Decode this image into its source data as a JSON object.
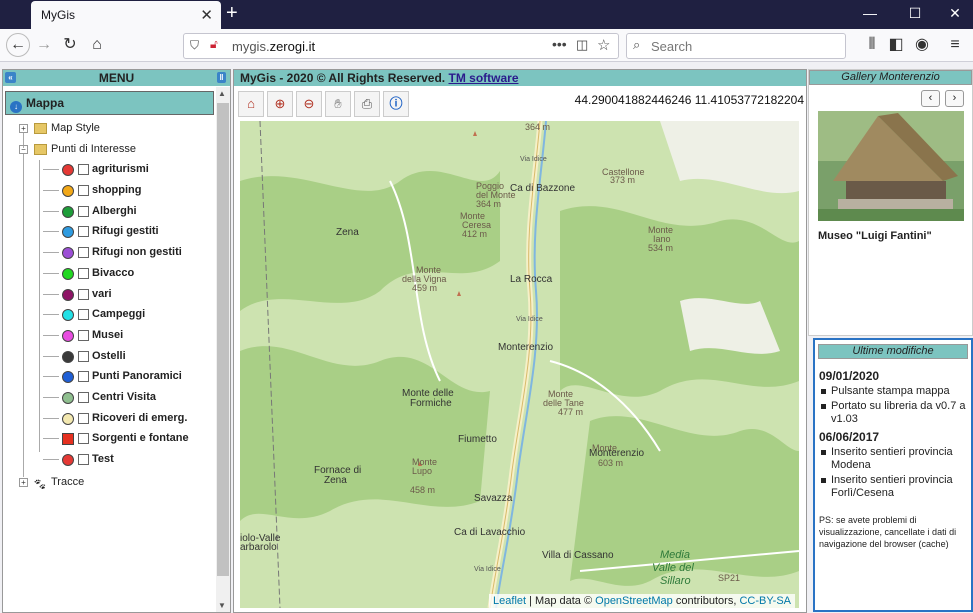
{
  "browser": {
    "tab_title": "MyGis",
    "url_prefix": "mygis.",
    "url_host": "zerogi.it",
    "search_placeholder": "Search"
  },
  "menu": {
    "title": "MENU",
    "mappa_label": "Mappa",
    "map_style_label": "Map Style",
    "poi_label": "Punti di Interesse",
    "tracce_label": "Tracce",
    "poi_items": [
      {
        "label": "agriturismi",
        "color": "#e53935"
      },
      {
        "label": "shopping",
        "color": "#f2a818"
      },
      {
        "label": "Alberghi",
        "color": "#1e9e3a"
      },
      {
        "label": "Rifugi gestiti",
        "color": "#2e9be0"
      },
      {
        "label": "Rifugi non gestiti",
        "color": "#9c4fd6"
      },
      {
        "label": "Bivacco",
        "color": "#22d822"
      },
      {
        "label": "vari",
        "color": "#8e1466"
      },
      {
        "label": "Campeggi",
        "color": "#22e0e6"
      },
      {
        "label": "Musei",
        "color": "#e84de0"
      },
      {
        "label": "Ostelli",
        "color": "#3a3a3a"
      },
      {
        "label": "Punti Panoramici",
        "color": "#1f5fd6"
      },
      {
        "label": "Centri Visita",
        "color": "#8fbf8f"
      },
      {
        "label": "Ricoveri di emerg.",
        "color": "#f3e8b0"
      },
      {
        "label": "Sorgenti e fontane",
        "color": "#e53020"
      },
      {
        "label": "Test",
        "color": "#e53935"
      }
    ]
  },
  "map": {
    "header_text": "MyGis - 2020 © All Rights Reserved. ",
    "header_link": "TM software",
    "coords": "44.290041882446246 11.41053772182204",
    "attribution": {
      "leaflet": "Leaflet",
      "sep": " | Map data © ",
      "osm": "OpenStreetMap",
      "contrib": " contributors, ",
      "license": "CC-BY-SA"
    },
    "labels": [
      {
        "text": "364 m"
      },
      {
        "text": "Ca di Bazzone"
      },
      {
        "text": "Poggio"
      },
      {
        "text": "del Monte"
      },
      {
        "text": "364 m"
      },
      {
        "text": "Castellone"
      },
      {
        "text": "373 m"
      },
      {
        "text": "Monte"
      },
      {
        "text": "Ceresa"
      },
      {
        "text": "412 m"
      },
      {
        "text": "Monte"
      },
      {
        "text": "Iano"
      },
      {
        "text": "534 m"
      },
      {
        "text": "Zena"
      },
      {
        "text": "Monte"
      },
      {
        "text": "della Vigna"
      },
      {
        "text": "459 m"
      },
      {
        "text": "La Rocca"
      },
      {
        "text": "Monterenzio"
      },
      {
        "text": "Monte delle"
      },
      {
        "text": "Formiche"
      },
      {
        "text": "Monte"
      },
      {
        "text": "delle Tane"
      },
      {
        "text": "477 m"
      },
      {
        "text": "Fiumetto"
      },
      {
        "text": "Monte"
      },
      {
        "text": "Monterenzio"
      },
      {
        "text": "603 m"
      },
      {
        "text": "Fornace di"
      },
      {
        "text": "Zena"
      },
      {
        "text": "Monte"
      },
      {
        "text": "Lupo"
      },
      {
        "text": "458 m"
      },
      {
        "text": "Savazza"
      },
      {
        "text": "Ca di Lavacchio"
      },
      {
        "text": "iolo-Valle"
      },
      {
        "text": "arbarolo"
      },
      {
        "text": "Villa di Cassano"
      },
      {
        "text": "Media"
      },
      {
        "text": "Valle del"
      },
      {
        "text": "Sillaro"
      },
      {
        "text": "SP21"
      },
      {
        "text": "Via Idice"
      },
      {
        "text": "Via Idice"
      },
      {
        "text": "Via Idice"
      }
    ]
  },
  "gallery": {
    "title": "Gallery Monterenzio",
    "caption": "Museo \"Luigi Fantini\""
  },
  "updates": {
    "title": "Ultime modifiche",
    "entries": [
      {
        "date": "09/01/2020",
        "items": [
          "Pulsante stampa mappa",
          "Portato su libreria da v0.7 a v1.03"
        ]
      },
      {
        "date": "06/06/2017",
        "items": [
          "Inserito sentieri provincia Modena",
          "Inserito sentieri provincia Forlì/Cesena"
        ]
      }
    ],
    "note": "PS: se avete problemi di visualizzazione, cancellate i dati di navigazione del browser (cache)"
  }
}
